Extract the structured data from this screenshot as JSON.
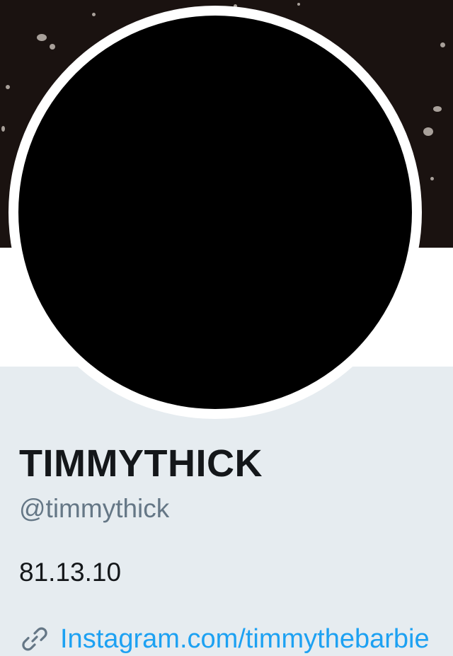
{
  "profile": {
    "display_name": "TIMMYTHICK",
    "handle": "@timmythick",
    "bio": "81.13.10",
    "website": {
      "icon": "link-icon",
      "label": "Instagram.com/timmythebarbie"
    }
  },
  "colors": {
    "header_background": "#1a1210",
    "profile_background": "#e6ecf0",
    "avatar": "#000000",
    "name_text": "#14171a",
    "handle_text": "#657786",
    "link": "#1da1f2"
  }
}
